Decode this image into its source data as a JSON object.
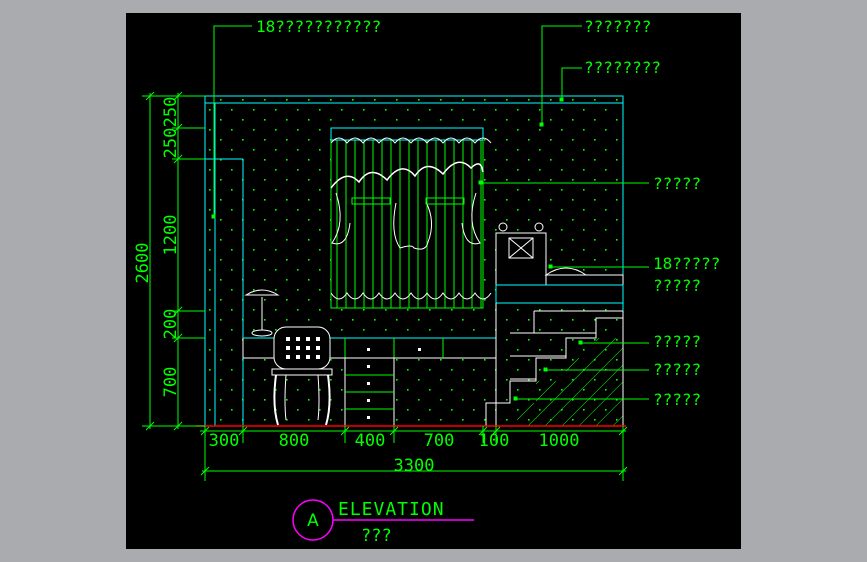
{
  "drawing": {
    "title": "ELEVATION",
    "subtitle": "???",
    "section_mark": "A",
    "colors": {
      "background": "#000000",
      "frame": "#a9abae",
      "line": "#00ff00",
      "cyan": "#00ffff",
      "white": "#ffffff",
      "magenta": "#ff00ff",
      "floor": "#ff0000"
    }
  },
  "callouts": {
    "top_left": "18???????????",
    "top_right_1": "???????",
    "top_right_2": "????????",
    "right_1": "?????",
    "right_2": "18?????",
    "right_3": "?????",
    "right_4": "?????",
    "right_5": "?????",
    "right_6": "?????"
  },
  "dimensions": {
    "vertical_total": "2600",
    "vertical": [
      "250",
      "250",
      "1200",
      "200",
      "700"
    ],
    "horizontal": [
      "300",
      "800",
      "400",
      "700",
      "100",
      "1000"
    ],
    "horizontal_total": "3300"
  }
}
